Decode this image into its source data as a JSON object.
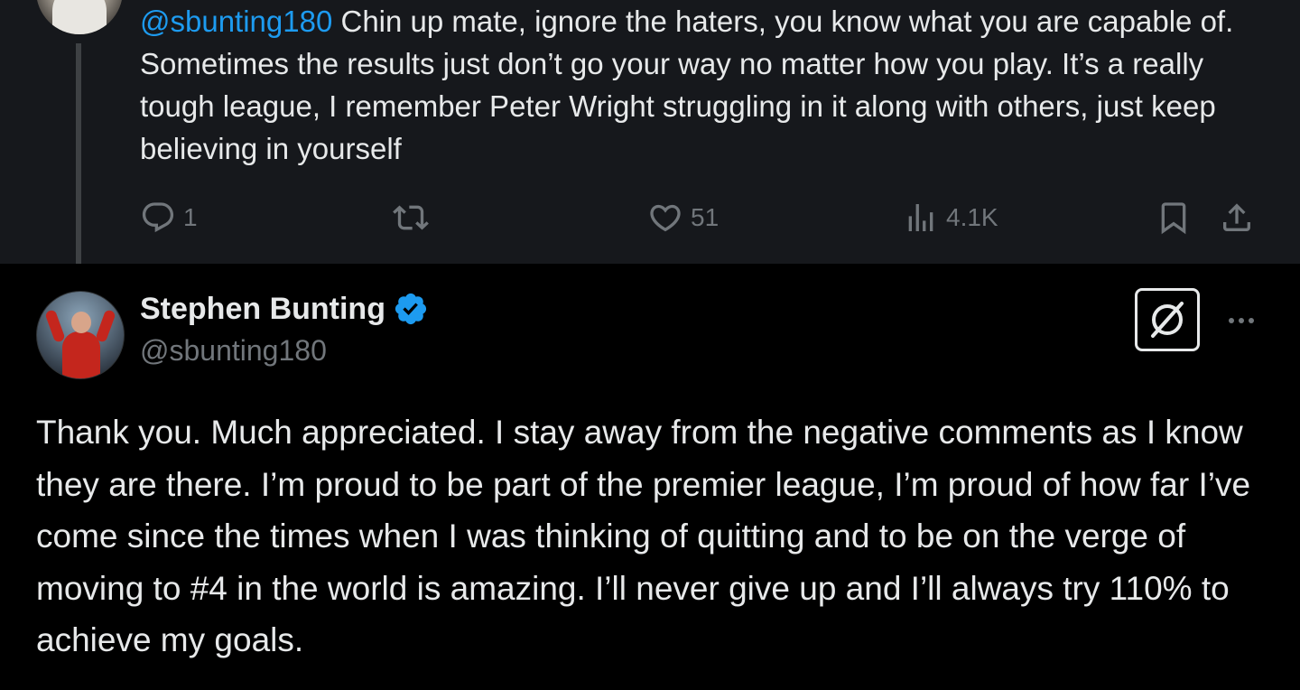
{
  "parent_tweet": {
    "mention": "@sbunting180",
    "text": " Chin up mate, ignore the haters, you know what you are capable of. Sometimes the results just don’t go your way no matter how you play. It’s a really tough league, I remember Peter Wright struggling in it along with others, just keep believing in yourself",
    "actions": {
      "reply_count": "1",
      "like_count": "51",
      "view_count": "4.1K"
    }
  },
  "main_tweet": {
    "display_name": "Stephen Bunting",
    "handle": "@sbunting180",
    "text": "Thank you. Much appreciated. I stay away from the negative comments as I know they are there. I’m proud to be part of the premier league, I’m proud of how far I’ve come since the times when I was thinking of quitting and to be on the verge of moving to #4 in the world is amazing. I’ll never give up and I’ll always try 110% to achieve my goals."
  },
  "icons": {
    "reply": "reply-icon",
    "retweet": "retweet-icon",
    "like": "heart-icon",
    "views": "views-icon",
    "bookmark": "bookmark-icon",
    "share": "share-icon",
    "verified": "verified-badge-icon",
    "grok": "grok-icon",
    "more": "more-icon"
  },
  "colors": {
    "accent": "#1d9bf0",
    "muted": "#71767b",
    "text": "#e7e9ea",
    "parent_bg": "#16181c",
    "main_bg": "#000000"
  }
}
